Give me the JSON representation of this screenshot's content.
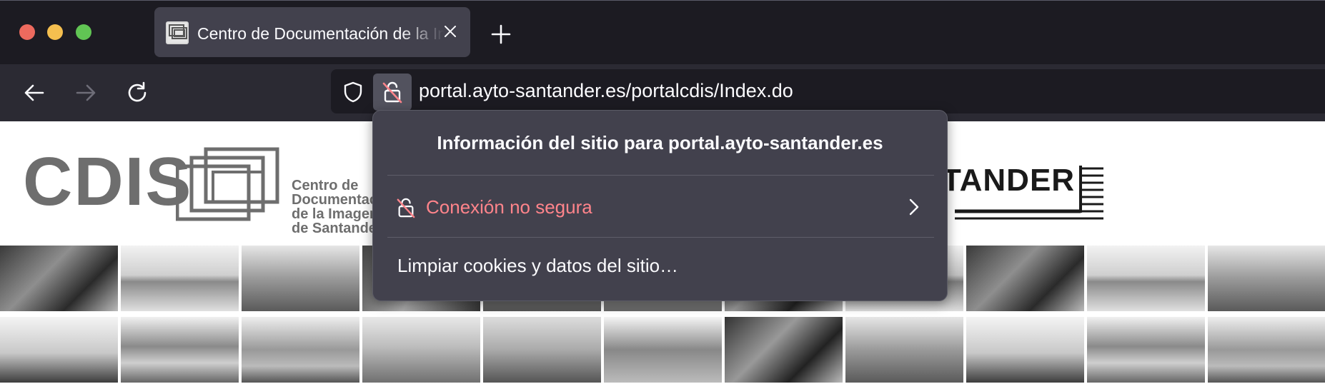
{
  "window": {
    "controls": [
      "close",
      "minimize",
      "maximize"
    ]
  },
  "tab": {
    "title": "Centro de Documentación de la Imagen de Santander",
    "favicon": "cdis-frame-icon"
  },
  "navbar": {
    "url": "portal.ayto-santander.es/portalcdis/Index.do"
  },
  "page": {
    "logo_text": "CDIS",
    "logo_subtitle": "Centro de\nDocumentación\nde la Imagen\nde Santander",
    "brand_right": "TANDER"
  },
  "site_info_popup": {
    "title": "Información del sitio para portal.ayto-santander.es",
    "connection_label": "Conexión no segura",
    "clear_label": "Limpiar cookies y datos del sitio…"
  },
  "colors": {
    "titlebar_bg": "#1c1b22",
    "navbar_bg": "#2b2a33",
    "popup_bg": "#42414d",
    "insecure_text": "#ff848b"
  }
}
